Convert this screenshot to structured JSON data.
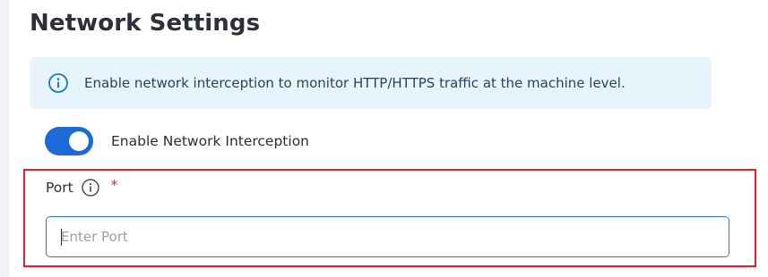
{
  "page": {
    "title": "Network Settings"
  },
  "info_banner": {
    "icon": "info-icon",
    "text": "Enable network interception to monitor HTTP/HTTPS traffic at the machine level."
  },
  "interception_toggle": {
    "label": "Enable Network Interception",
    "enabled": true
  },
  "port_field": {
    "label": "Port",
    "required_marker": "*",
    "info_icon": "info-icon",
    "placeholder": "Enter Port",
    "value": ""
  },
  "colors": {
    "accent": "#1b6ad6",
    "banner_background": "#e8f4fb",
    "banner_text": "#24455c",
    "required": "#e0202a",
    "highlight_border": "#e0202a",
    "input_border": "#2d78c4"
  }
}
